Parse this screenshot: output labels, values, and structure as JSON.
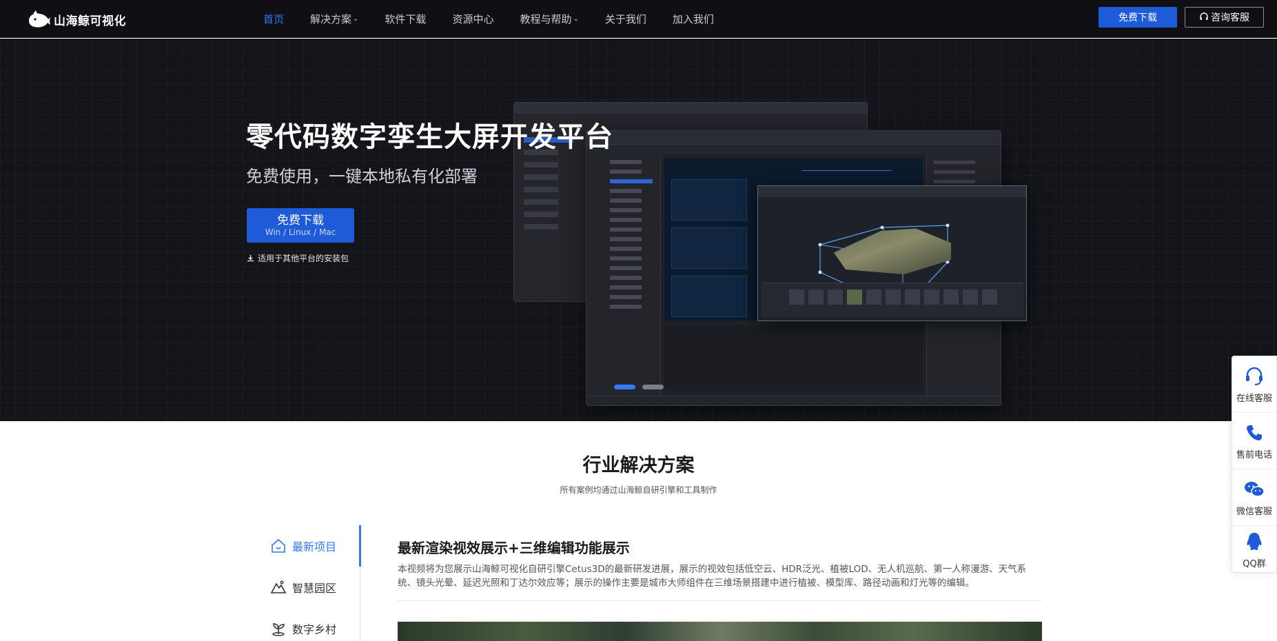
{
  "nav": {
    "brand": "山海鲸可视化",
    "links": [
      {
        "label": "首页",
        "dropdown": false
      },
      {
        "label": "解决方案",
        "dropdown": true
      },
      {
        "label": "软件下载",
        "dropdown": false
      },
      {
        "label": "资源中心",
        "dropdown": false
      },
      {
        "label": "教程与帮助",
        "dropdown": true
      },
      {
        "label": "关于我们",
        "dropdown": false
      },
      {
        "label": "加入我们",
        "dropdown": false
      }
    ],
    "download_label": "免费下载",
    "consult_label": "咨询客服"
  },
  "hero": {
    "title": "零代码数字孪生大屏开发平台",
    "subtitle": "免费使用，一键本地私有化部署",
    "button_main": "免费下载",
    "button_platforms": "Win / Linux / Mac",
    "other_platforms": "适用于其他平台的安装包",
    "slides": 2,
    "active_slide": 1
  },
  "solutions": {
    "title": "行业解决方案",
    "subtitle": "所有案例均通过山海鲸自研引擎和工具制作",
    "tabs": [
      {
        "label": "最新项目",
        "icon": "home-icon"
      },
      {
        "label": "智慧园区",
        "icon": "mountain-icon"
      },
      {
        "label": "数字乡村",
        "icon": "sprout-icon"
      }
    ],
    "content_title": "最新渲染视效展示+三维编辑功能展示",
    "content_desc": "本视频将为您展示山海鲸可视化自研引擎Cetus3D的最新研发进展，展示的视效包括低空云、HDR泛光、植被LOD、无人机巡航、第一人称漫游、天气系统、镜头光晕、延迟光照和丁达尔效应等；展示的操作主要是城市大师组件在三维场景搭建中进行植被、模型库、路径动画和灯光等的编辑。"
  },
  "float_sidebar": [
    {
      "label": "在线客服",
      "icon": "headset-icon"
    },
    {
      "label": "售前电话",
      "icon": "phone-icon"
    },
    {
      "label": "微信客服",
      "icon": "wechat-icon"
    },
    {
      "label": "QQ群",
      "icon": "qq-icon"
    }
  ],
  "colors": {
    "accent": "#1e5bd9",
    "active": "#2f7cf6",
    "nav_bg": "#101014",
    "hero_bg": "#14151a"
  }
}
